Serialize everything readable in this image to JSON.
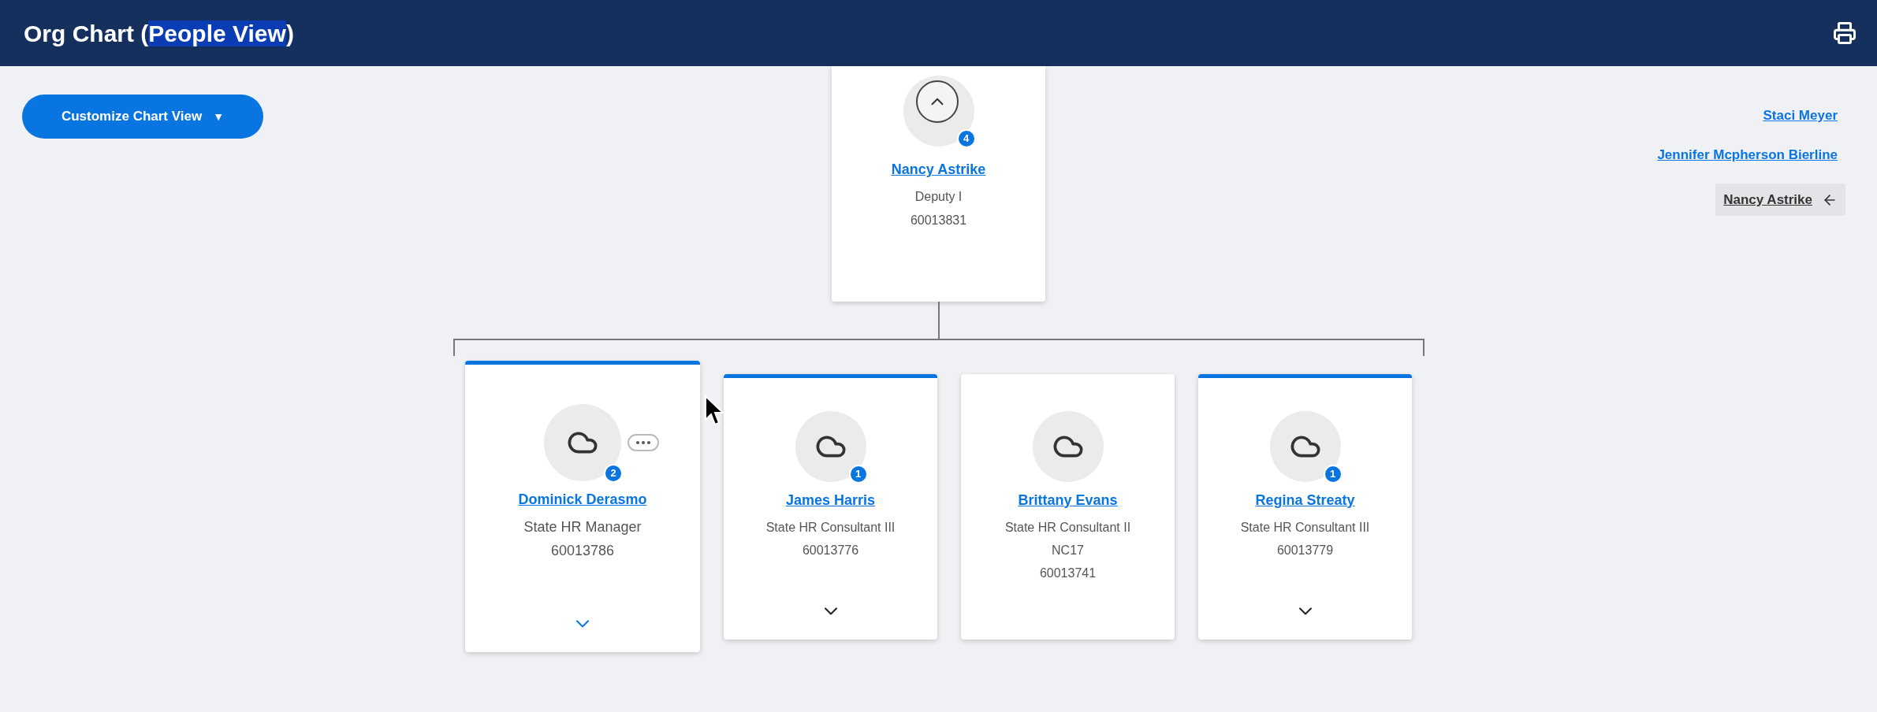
{
  "header": {
    "title_parts": [
      {
        "text": "Org Chart (",
        "highlighted": false
      },
      {
        "text": "People View",
        "highlighted": true
      },
      {
        "text": ")",
        "highlighted": false
      }
    ]
  },
  "customize_button": {
    "label": "Customize Chart View",
    "caret": "▼"
  },
  "manager": {
    "name": "Nancy Astrike",
    "lines": [
      "Deputy I",
      "60013831"
    ],
    "reports": "4"
  },
  "reports": [
    {
      "name": "Dominick Derasmo",
      "lines": [
        "State HR Manager",
        "60013786"
      ],
      "reports": "2",
      "selected": true,
      "actions_menu": true,
      "expandable": true
    },
    {
      "name": "James Harris",
      "lines": [
        "State HR Consultant III",
        "60013776"
      ],
      "reports": "1",
      "selected": false,
      "actions_menu": false,
      "expandable": true
    },
    {
      "name": "Brittany Evans",
      "lines": [
        "State HR Consultant II",
        "NC17",
        "60013741"
      ],
      "selected": false,
      "actions_menu": false,
      "expandable": false
    },
    {
      "name": "Regina Streaty",
      "lines": [
        "State HR Consultant III",
        "60013779"
      ],
      "reports": "1",
      "selected": false,
      "actions_menu": false,
      "expandable": true
    }
  ],
  "breadcrumbs": [
    {
      "name": "Staci Meyer",
      "selected": false
    },
    {
      "name": "Jennifer Mcpherson Bierline",
      "selected": false
    },
    {
      "name": "Nancy Astrike",
      "selected": true
    }
  ]
}
